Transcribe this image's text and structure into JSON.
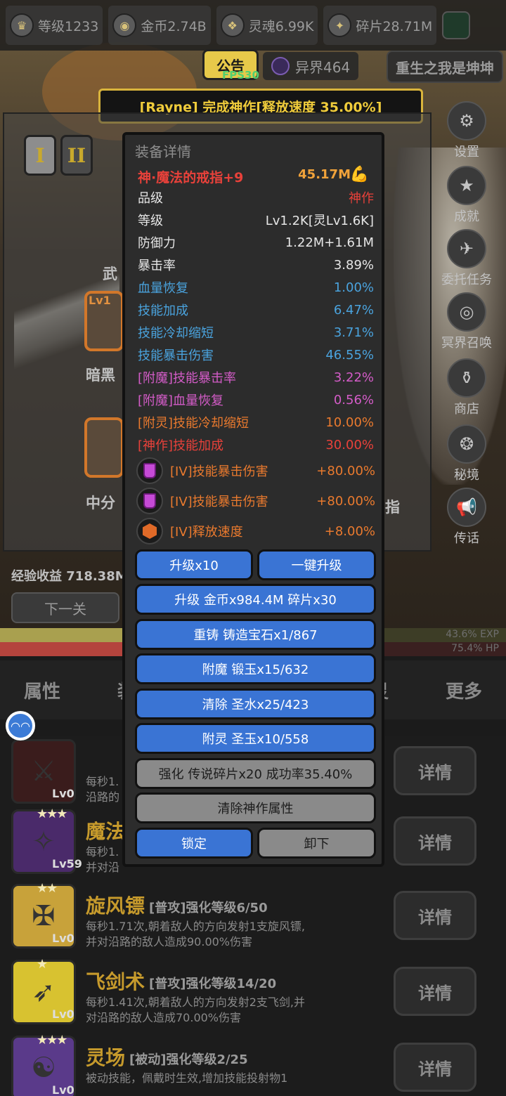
{
  "resources": [
    {
      "icon": "crown-icon",
      "label": "等级1233"
    },
    {
      "icon": "coin-icon",
      "label": "金币2.74B"
    },
    {
      "icon": "soul-icon",
      "label": "灵魂6.99K"
    },
    {
      "icon": "shard-icon",
      "label": "碎片28.71M"
    }
  ],
  "notice": {
    "label": "公告",
    "fps": "FPS30"
  },
  "otherworld": {
    "label": "异界464"
  },
  "rebirth": {
    "label": "重生之我是坤坤"
  },
  "banner": {
    "text": "[Rayne] 完成神作[释放速度 35.00%]"
  },
  "hero": {
    "tab1": "I",
    "tab2": "II",
    "weapon_label": "武",
    "slot1_level": "Lv1",
    "slot1_name": "暗黑",
    "slot2_name": "中分",
    "right_partial": "指",
    "exp_income": "经验收益 718.38M",
    "next_level": "下一关"
  },
  "side_menu": [
    {
      "icon": "settings-icon",
      "label": "设置"
    },
    {
      "icon": "trophy-icon",
      "label": "成就"
    },
    {
      "icon": "task-icon",
      "label": "委托任务"
    },
    {
      "icon": "summon-icon",
      "label": "冥界召唤"
    },
    {
      "icon": "shop-icon",
      "label": "商店"
    },
    {
      "icon": "portal-icon",
      "label": "秘境"
    },
    {
      "icon": "horn-icon",
      "label": "传话"
    }
  ],
  "bars": {
    "exp_label": "43.6% EXP",
    "hp_label": "75.4% HP",
    "exp_fill": 0.436,
    "hp_fill": 0.754
  },
  "bottom_tabs": [
    "属性",
    "装",
    "",
    "",
    "灵",
    "更多"
  ],
  "dialog": {
    "title": "装备详情",
    "item_name": "神·魔法的戒指+9",
    "power": "45.17M",
    "stats": [
      {
        "k": "品级",
        "v": "神作",
        "kc": "white",
        "vc": "red"
      },
      {
        "k": "等级",
        "v": "Lv1.2K[灵Lv1.6K]",
        "kc": "white",
        "vc": "white"
      },
      {
        "k": "防御力",
        "v": "1.22M+1.61M",
        "kc": "white",
        "vc": "white"
      },
      {
        "k": "暴击率",
        "v": "3.89%",
        "kc": "white",
        "vc": "white"
      },
      {
        "k": "血量恢复",
        "v": "1.00%",
        "kc": "blue",
        "vc": "blue"
      },
      {
        "k": "技能加成",
        "v": "6.47%",
        "kc": "blue",
        "vc": "blue"
      },
      {
        "k": "技能冷却缩短",
        "v": "3.71%",
        "kc": "blue",
        "vc": "blue"
      },
      {
        "k": "技能暴击伤害",
        "v": "46.55%",
        "kc": "blue",
        "vc": "blue"
      },
      {
        "k": "[附魔]技能暴击率",
        "v": "3.22%",
        "kc": "pink",
        "vc": "pink"
      },
      {
        "k": "[附魔]血量恢复",
        "v": "0.56%",
        "kc": "pink",
        "vc": "pink"
      },
      {
        "k": "[附灵]技能冷却缩短",
        "v": "10.00%",
        "kc": "orange",
        "vc": "orange"
      },
      {
        "k": "[神作]技能加成",
        "v": "30.00%",
        "kc": "red",
        "vc": "red"
      }
    ],
    "gems": [
      {
        "type": "cup",
        "k": "[IV]技能暴击伤害",
        "v": "+80.00%"
      },
      {
        "type": "cup",
        "k": "[IV]技能暴击伤害",
        "v": "+80.00%"
      },
      {
        "type": "hex",
        "k": "[IV]释放速度",
        "v": "+8.00%"
      }
    ],
    "buttons": {
      "upgrade_x10": "升级x10",
      "one_click": "一键升级",
      "upgrade_cost": "升级 金币x984.4M 碎片x30",
      "recast": "重铸 铸造宝石x1/867",
      "enchant": "附魔 锻玉x15/632",
      "purge": "清除 圣水x25/423",
      "spirit": "附灵 圣玉x10/558",
      "strengthen": "强化 传说碎片x20 成功率35.40%",
      "clear_divine": "清除神作属性",
      "lock": "锁定",
      "unequip": "卸下"
    }
  },
  "skills": [
    {
      "name": "",
      "tag": "",
      "lv": "Lv0",
      "stars": "",
      "desc_a": "每秒1.",
      "desc_b": "沿路的",
      "detail": "详情",
      "bg": "#3a1c1c"
    },
    {
      "name": "魔法",
      "tag": "",
      "lv": "Lv59",
      "stars": "★★★",
      "desc_a": "每秒1.",
      "desc_b": "并对沿",
      "detail": "详情",
      "bg": "#4a2a6a"
    },
    {
      "name": "旋风镖",
      "tag": "[普攻]强化等级6/50",
      "lv": "Lv0",
      "stars": "★★",
      "desc_a": "每秒1.71次,朝着敌人的方向发射1支旋风镖,",
      "desc_b": "并对沿路的敌人造成90.00%伤害",
      "detail": "详情",
      "bg": "#c8a23a"
    },
    {
      "name": "飞剑术",
      "tag": "[普攻]强化等级14/20",
      "lv": "Lv0",
      "stars": "★",
      "desc_a": "每秒1.41次,朝着敌人的方向发射2支飞剑,并",
      "desc_b": "对沿路的敌人造成70.00%伤害",
      "detail": "详情",
      "bg": "#d8c230"
    },
    {
      "name": "灵场",
      "tag": "[被动]强化等级2/25",
      "lv": "Lv0",
      "stars": "★★★",
      "desc_a": "被动技能，佩戴时生效,增加技能投射物1",
      "desc_b": "",
      "detail": "详情",
      "bg": "#5a3a8a"
    }
  ]
}
